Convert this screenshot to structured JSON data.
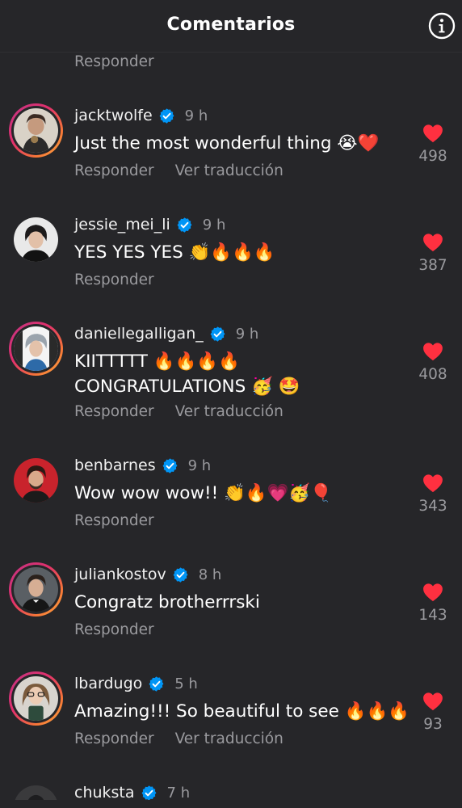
{
  "header": {
    "title": "Comentarios",
    "info_icon": "info-circle-icon"
  },
  "colors": {
    "background": "#262629",
    "like_red": "#ff3040",
    "verified_blue": "#0095f6",
    "muted_text": "#9a9a9e"
  },
  "previous_comment": {
    "reply_label": "Responder"
  },
  "comments": [
    {
      "username": "jacktwolfe",
      "verified": true,
      "time": "9 h",
      "text_lines": [
        "Just the most wonderful thing 😭❤️"
      ],
      "reply_label": "Responder",
      "translate_label": "Ver traducción",
      "likes": "498",
      "story_ring": true
    },
    {
      "username": "jessie_mei_li",
      "verified": true,
      "time": "9 h",
      "text_lines": [
        "YES YES YES 👏🔥🔥🔥"
      ],
      "reply_label": "Responder",
      "translate_label": "",
      "likes": "387",
      "story_ring": false
    },
    {
      "username": "daniellegalligan_",
      "verified": true,
      "time": "9 h",
      "text_lines": [
        "KIITTTTT 🔥🔥🔥🔥",
        "CONGRATULATIONS 🥳 🤩"
      ],
      "reply_label": "Responder",
      "translate_label": "Ver traducción",
      "likes": "408",
      "story_ring": true
    },
    {
      "username": "benbarnes",
      "verified": true,
      "time": "9 h",
      "text_lines": [
        "Wow wow wow!! 👏🔥💗🥳🎈"
      ],
      "reply_label": "Responder",
      "translate_label": "",
      "likes": "343",
      "story_ring": false
    },
    {
      "username": "juliankostov",
      "verified": true,
      "time": "8 h",
      "text_lines": [
        "Congratz brotherrrski"
      ],
      "reply_label": "Responder",
      "translate_label": "",
      "likes": "143",
      "story_ring": true
    },
    {
      "username": "lbardugo",
      "verified": true,
      "time": "5 h",
      "text_lines": [
        "Amazing!!! So beautiful to see 🔥🔥🔥"
      ],
      "reply_label": "Responder",
      "translate_label": "Ver traducción",
      "likes": "93",
      "story_ring": true
    },
    {
      "username": "chuksta",
      "verified": true,
      "time": "7 h",
      "text_lines": [],
      "reply_label": "",
      "translate_label": "",
      "likes": "",
      "story_ring": false
    }
  ]
}
